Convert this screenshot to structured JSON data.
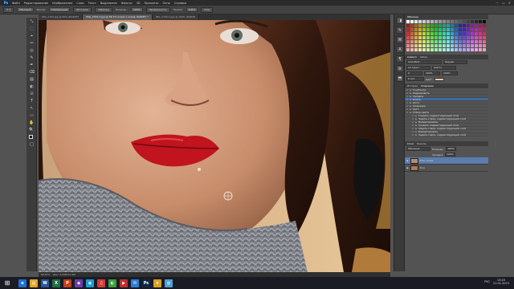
{
  "menubar": {
    "logo": "Ps",
    "items": [
      "Файл",
      "Редактирование",
      "Изображение",
      "Слои",
      "Текст",
      "Выделение",
      "Фильтр",
      "3D",
      "Просмотр",
      "Окно",
      "Справка"
    ],
    "win_controls": [
      "—",
      "▭",
      "✕"
    ]
  },
  "options": {
    "preset": "Обычный",
    "labels": [
      "Режим:",
      "Нормальный",
      "Непрозр.:",
      "100%",
      "Нажим:",
      "100%"
    ],
    "buttons": [
      "Источник",
      "Образец",
      "Прозрачность",
      "Узор"
    ]
  },
  "tabs": [
    {
      "label": "IMG_1709.jpg @ 50% (RGB/8*)",
      "active": false
    },
    {
      "label": "IMG_1709-3.jpg @ 66.7% (Слой 1 копия, RGB/8*) *",
      "active": true
    },
    {
      "label": "IMG_1709-2.jpg @ 100% (RGB/8)",
      "active": false
    }
  ],
  "tools": [
    "⤡",
    "⬚",
    "⌖",
    "✂",
    "◎",
    "✎",
    "✒",
    "⌫",
    "▨",
    "◐",
    "⊙",
    "T",
    "↖",
    "▭",
    "✋",
    "🔍",
    "■",
    "□"
  ],
  "status": {
    "zoom": "66.67%",
    "doc": "Док: 5,93M/11,9M"
  },
  "dock_icons": [
    "◨",
    "✎",
    "⌘",
    "A",
    "¶",
    "⚙",
    "⬒"
  ],
  "panels": {
    "swatches_tab": "Образцы",
    "character_tab": "Символ",
    "paragraph_tab": "Абзац",
    "font": "Arial Bold",
    "font_style": "Regular",
    "size": "12 пункт",
    "leading": "(Авто)",
    "tracking": "0",
    "scale_v": "100%",
    "scale_h": "100%",
    "baseline": "0 пкт",
    "color_label": "Цвет:",
    "history_tab": "История",
    "actions_tab": "Операции",
    "history": [
      {
        "label": "Тон/Контр",
        "sub": false,
        "active": false
      },
      {
        "label": "Кадрировать",
        "sub": false,
        "active": false
      },
      {
        "label": "Заливка",
        "sub": false,
        "active": false
      },
      {
        "label": "Контр.",
        "sub": false,
        "active": true
      },
      {
        "label": "Фото",
        "sub": false,
        "active": false
      },
      {
        "label": "Операции",
        "sub": false,
        "active": false
      },
      {
        "label": "Set 1",
        "sub": false,
        "active": false
      },
      {
        "label": "Отбор цвета",
        "sub": false,
        "active": false
      },
      {
        "label": "Создать корректирующий слой",
        "sub": true,
        "active": false
      },
      {
        "label": "Задать говор, корректирующий слой",
        "sub": true,
        "active": false
      },
      {
        "label": "Инвертировать",
        "sub": true,
        "active": false
      },
      {
        "label": "Создать корректирующий слой",
        "sub": true,
        "active": false
      },
      {
        "label": "Задать говор, корректирующий слой",
        "sub": true,
        "active": false
      },
      {
        "label": "Инвертировать",
        "sub": true,
        "active": false
      },
      {
        "label": "Задать говор, корректирующий слой",
        "sub": true,
        "active": false
      }
    ],
    "layers_tab": "Слои",
    "channels_tab": "Каналы",
    "blend_mode": "Обычные",
    "opacity_label": "Непрозр.:",
    "opacity": "100%",
    "fill_label": "Заливка:",
    "fill": "100%",
    "layers": [
      {
        "name": "Фон копия",
        "active": true
      },
      {
        "name": "Фон",
        "active": false
      }
    ]
  },
  "taskbar": {
    "start": "⊞",
    "apps": [
      {
        "glyph": "e",
        "color": "#1e6fd1"
      },
      {
        "glyph": "▤",
        "color": "#e1a626"
      },
      {
        "glyph": "W",
        "color": "#2b5797"
      },
      {
        "glyph": "X",
        "color": "#1e7145"
      },
      {
        "glyph": "P",
        "color": "#c43e1c"
      },
      {
        "glyph": "◆",
        "color": "#6a3fb0"
      },
      {
        "glyph": "◉",
        "color": "#1d9ad6"
      },
      {
        "glyph": "♫",
        "color": "#d13a3a"
      },
      {
        "glyph": "◐",
        "color": "#3a9f3a"
      },
      {
        "glyph": "▶",
        "color": "#c0302b"
      },
      {
        "glyph": "✉",
        "color": "#2a7fd4"
      },
      {
        "glyph": "Ps",
        "color": "#0d2a47"
      },
      {
        "glyph": "★",
        "color": "#d8a021"
      },
      {
        "glyph": "◍",
        "color": "#4aa3d8"
      }
    ],
    "time": "13:43",
    "date": "21.01.2015",
    "lang": "РУС"
  }
}
